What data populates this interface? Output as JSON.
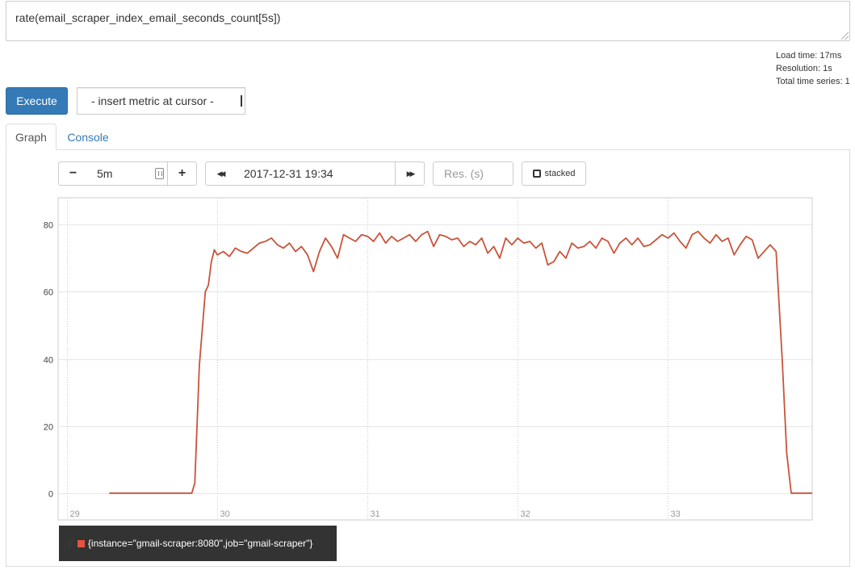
{
  "query": {
    "expression": "rate(email_scraper_index_email_seconds_count[5s])"
  },
  "stats": {
    "load_time": "Load time: 17ms",
    "resolution": "Resolution: 1s",
    "total_series": "Total time series: 1"
  },
  "toolbar": {
    "execute_label": "Execute",
    "insert_metric_label": "- insert metric at cursor -"
  },
  "tabs": {
    "graph": "Graph",
    "console": "Console"
  },
  "graph_controls": {
    "range_value": "5m",
    "end_time": "2017-12-31 19:34",
    "resolution_placeholder": "Res. (s)",
    "stacked_label": "stacked",
    "minus_glyph": "−",
    "plus_glyph": "+",
    "back_glyph": "◀◀",
    "fwd_glyph": "▶▶"
  },
  "legend": {
    "series_label": "{instance=\"gmail-scraper:8080\",job=\"gmail-scraper\"}",
    "check_glyph": "✔"
  },
  "colors": {
    "series": "#c8543a",
    "accent": "#337ab7"
  },
  "chart_data": {
    "type": "line",
    "x_tick_labels": [
      "29",
      "30",
      "31",
      "32",
      "33"
    ],
    "x_ticks": [
      29,
      30,
      31,
      32,
      33
    ],
    "xlim": [
      28.94,
      33.96
    ],
    "y_tick_labels": [
      "0",
      "20",
      "40",
      "60",
      "80"
    ],
    "y_ticks": [
      0,
      20,
      40,
      60,
      80
    ],
    "ylim": [
      -8,
      88
    ],
    "grid": true,
    "series": [
      {
        "name": "{instance=\"gmail-scraper:8080\",job=\"gmail-scraper\"}",
        "x": [
          29.28,
          29.83,
          29.85,
          29.88,
          29.92,
          29.94,
          29.96,
          29.98,
          30.0,
          30.04,
          30.08,
          30.12,
          30.16,
          30.2,
          30.24,
          30.28,
          30.32,
          30.36,
          30.4,
          30.44,
          30.48,
          30.52,
          30.56,
          30.6,
          30.64,
          30.68,
          30.72,
          30.76,
          30.8,
          30.84,
          30.88,
          30.92,
          30.96,
          31.0,
          31.04,
          31.08,
          31.12,
          31.16,
          31.2,
          31.24,
          31.28,
          31.32,
          31.36,
          31.4,
          31.44,
          31.48,
          31.52,
          31.56,
          31.6,
          31.64,
          31.68,
          31.72,
          31.76,
          31.8,
          31.84,
          31.88,
          31.92,
          31.96,
          32.0,
          32.04,
          32.08,
          32.12,
          32.16,
          32.2,
          32.24,
          32.28,
          32.32,
          32.36,
          32.4,
          32.44,
          32.48,
          32.52,
          32.56,
          32.6,
          32.64,
          32.68,
          32.72,
          32.76,
          32.8,
          32.84,
          32.88,
          32.92,
          32.96,
          33.0,
          33.04,
          33.08,
          33.12,
          33.16,
          33.2,
          33.24,
          33.28,
          33.32,
          33.36,
          33.4,
          33.44,
          33.48,
          33.52,
          33.56,
          33.6,
          33.64,
          33.68,
          33.72,
          33.76,
          33.79,
          33.82,
          33.85,
          33.87,
          33.9,
          33.96
        ],
        "values": [
          0,
          0,
          3,
          38,
          60,
          62,
          69,
          72.5,
          71,
          72,
          70.5,
          73,
          72,
          71.5,
          73,
          74.5,
          75,
          76,
          74,
          73,
          74.5,
          72,
          73.5,
          71,
          66,
          72,
          76,
          73.5,
          70,
          77,
          76,
          75,
          77,
          76.5,
          75,
          77.5,
          74.5,
          76.5,
          75,
          76,
          77,
          75,
          77,
          78,
          73.5,
          77,
          76.5,
          75.5,
          76,
          73.5,
          75,
          74,
          76,
          71.5,
          73.5,
          70,
          76,
          74,
          76,
          74.5,
          75,
          73,
          74.5,
          68,
          69,
          72,
          70,
          74.5,
          73,
          73.5,
          75,
          73,
          76,
          75,
          71.5,
          74.5,
          76,
          74,
          76,
          73.5,
          74,
          75.5,
          77,
          76,
          77.5,
          75,
          73,
          77,
          78,
          76,
          74.5,
          77,
          75,
          76,
          71,
          74,
          76.5,
          75.5,
          70,
          72,
          74,
          72,
          40,
          12,
          0,
          0,
          0,
          0,
          0
        ]
      }
    ]
  }
}
